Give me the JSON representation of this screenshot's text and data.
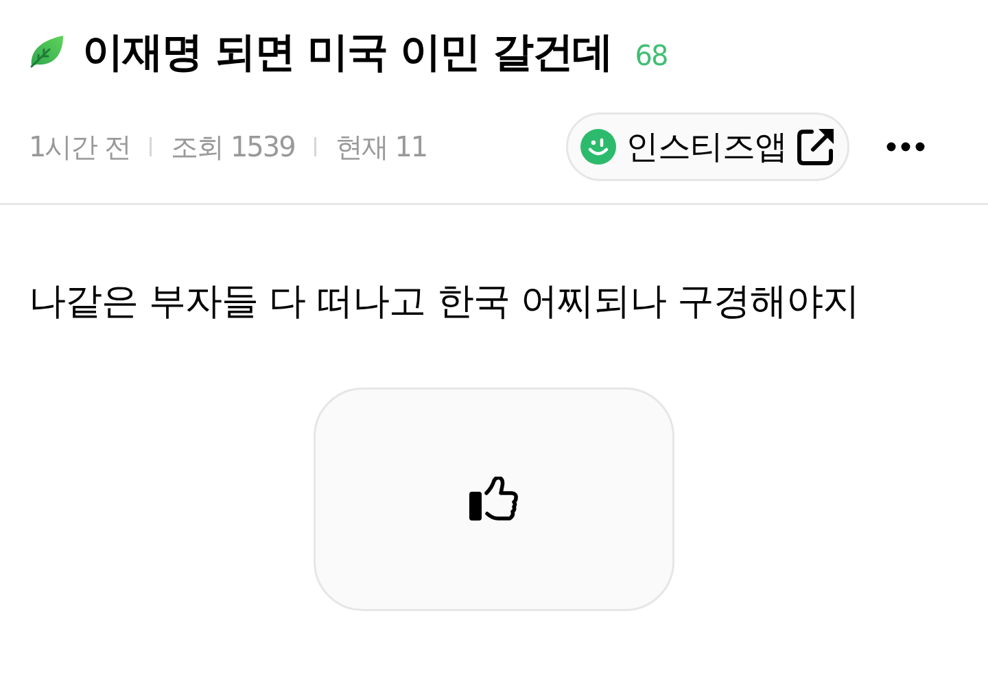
{
  "post": {
    "title": "이재명 되면 미국 이민 갈건데",
    "comment_count": "68"
  },
  "meta": [
    "1시간 전",
    "조회 1539",
    "현재 11"
  ],
  "app_button": {
    "label": "인스티즈앱"
  },
  "body": "나같은 부자들 다 떠나고 한국 어찌되나 구경해야지"
}
